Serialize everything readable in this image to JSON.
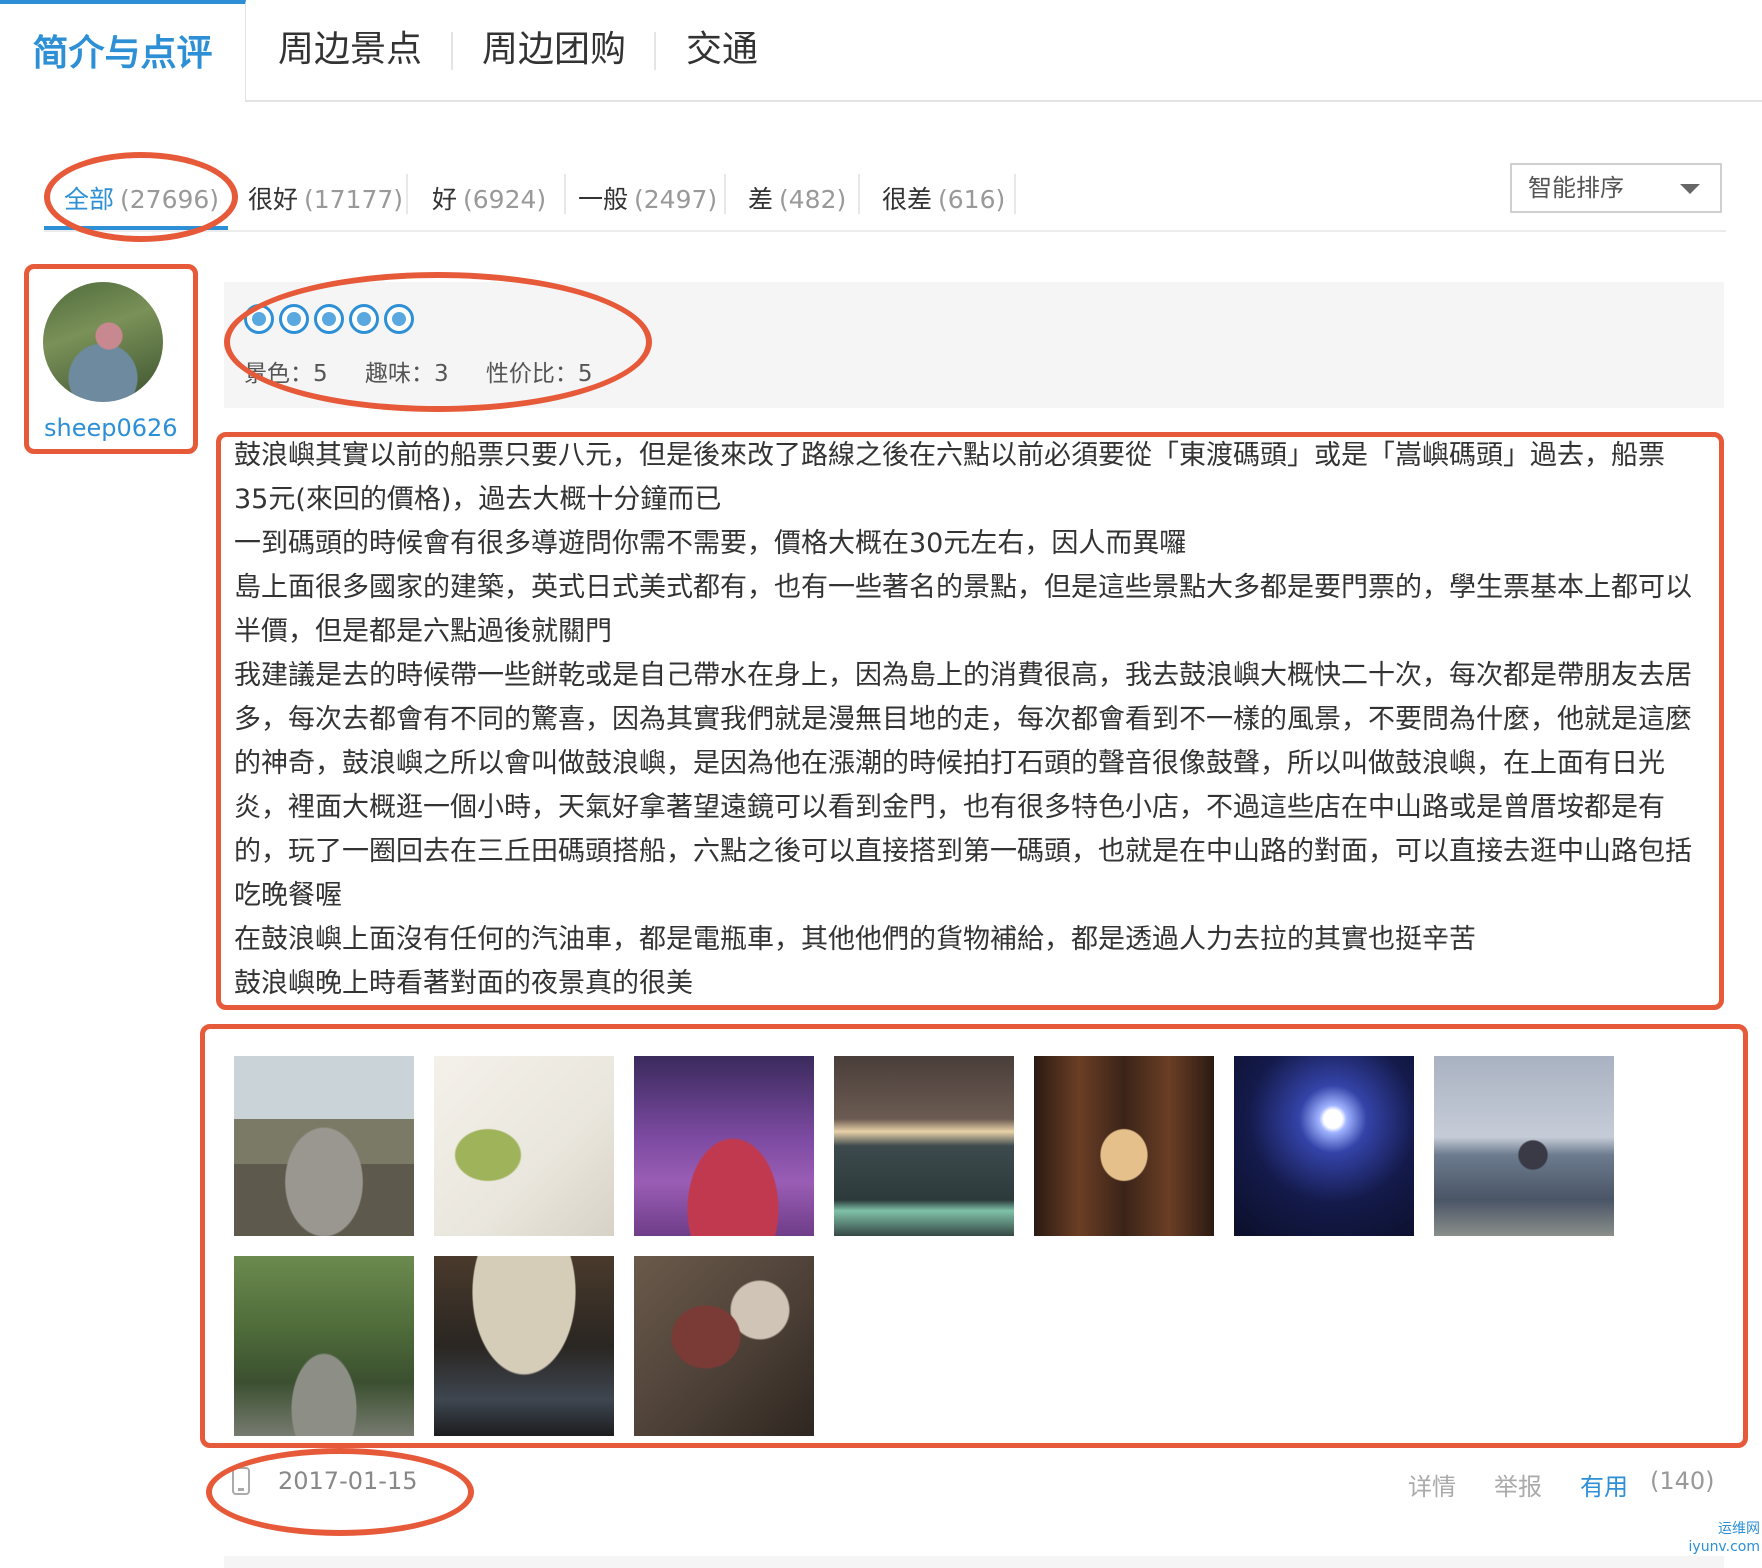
{
  "tabs": [
    {
      "label": "简介与点评"
    },
    {
      "label": "周边景点"
    },
    {
      "label": "周边团购"
    },
    {
      "label": "交通"
    }
  ],
  "filters": [
    {
      "label": "全部",
      "count": "(27696)"
    },
    {
      "label": "很好",
      "count": "(17177)"
    },
    {
      "label": "好",
      "count": "(6924)"
    },
    {
      "label": "一般",
      "count": "(2497)"
    },
    {
      "label": "差",
      "count": "(482)"
    },
    {
      "label": "很差",
      "count": "(616)"
    }
  ],
  "sort": {
    "label": "智能排序"
  },
  "review": {
    "user": "sheep0626",
    "stars": 5,
    "scores": [
      "景色：5",
      "趣味：3",
      "性价比：5"
    ],
    "paragraphs": [
      "鼓浪嶼其實以前的船票只要八元，但是後來改了路線之後在六點以前必須要從「東渡碼頭」或是「嵩嶼碼頭」過去，船票35元(來回的價格)，過去大概十分鐘而已",
      "一到碼頭的時候會有很多導遊問你需不需要，價格大概在30元左右，因人而異囉",
      "島上面很多國家的建築，英式日式美式都有，也有一些著名的景點，但是這些景點大多都是要門票的，學生票基本上都可以半價，但是都是六點過後就關門",
      "我建議是去的時候帶一些餅乾或是自己帶水在身上，因為島上的消費很高，我去鼓浪嶼大概快二十次，每次都是帶朋友去居多，每次去都會有不同的驚喜，因為其實我們就是漫無目地的走，每次都會看到不一樣的風景，不要問為什麼，他就是這麼的神奇，鼓浪嶼之所以會叫做鼓浪嶼，是因為他在漲潮的時候拍打石頭的聲音很像鼓聲，所以叫做鼓浪嶼，在上面有日光炎，裡面大概逛一個小時，天氣好拿著望遠鏡可以看到金門，也有很多特色小店，不過這些店在中山路或是曾厝垵都是有的，玩了一圈回去在三丘田碼頭搭船，六點之後可以直接搭到第一碼頭，也就是在中山路的對面，可以直接去逛中山路包括吃晚餐喔",
      "在鼓浪嶼上面沒有任何的汽油車，都是電瓶車，其他他們的貨物補給，都是透過人力去拉的其實也挺辛苦",
      "鼓浪嶼晚上時看著對面的夜景真的很美"
    ],
    "date": "2017-01-15",
    "actions": {
      "detail": "详情",
      "report": "举报",
      "useful": "有用",
      "useful_count": "(140)"
    }
  },
  "watermark": {
    "line1": "运维网",
    "line2": "iyunv.com"
  },
  "colors": {
    "accent": "#2d8fd5",
    "annotation": "#e65a3a"
  }
}
